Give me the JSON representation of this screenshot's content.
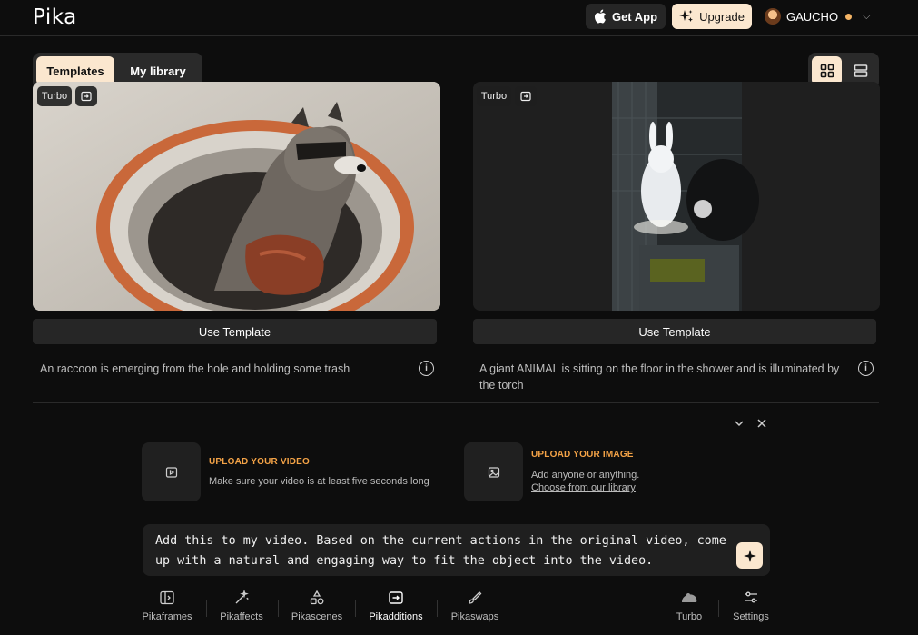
{
  "header": {
    "logo": "Pika",
    "get_app_label": "Get App",
    "upgrade_label": "Upgrade",
    "username": "GAUCHO"
  },
  "tabs": [
    {
      "label": "Templates",
      "active": true
    },
    {
      "label": "My library",
      "active": false
    }
  ],
  "view_toggle": {
    "active": "grid"
  },
  "cards": [
    {
      "badge": "Turbo",
      "button_label": "Use Template",
      "description": "An raccoon is emerging from the hole and holding some trash"
    },
    {
      "badge": "Turbo",
      "button_label": "Use Template",
      "description": "A giant ANIMAL is sitting on the floor in the shower and is illuminated by the torch"
    }
  ],
  "upload": {
    "video": {
      "title": "UPLOAD YOUR VIDEO",
      "subtitle": "Make sure your video is at least five seconds long"
    },
    "image": {
      "title": "UPLOAD YOUR IMAGE",
      "subtitle": "Add anyone or anything.",
      "link": "Choose from our library"
    }
  },
  "prompt": {
    "text": "Add this to my video. Based on the current actions in the original video, come up with a natural and engaging way to fit the object into the video."
  },
  "toolbar": {
    "items": [
      {
        "label": "Pikaframes",
        "icon": "frames-icon"
      },
      {
        "label": "Pikaffects",
        "icon": "magic-wand-icon"
      },
      {
        "label": "Pikascenes",
        "icon": "shapes-icon"
      },
      {
        "label": "Pikadditions",
        "icon": "add-box-icon",
        "active": true
      },
      {
        "label": "Pikaswaps",
        "icon": "brush-icon"
      },
      {
        "label": "Turbo",
        "icon": "turbo-icon"
      },
      {
        "label": "Settings",
        "icon": "sliders-icon"
      }
    ]
  },
  "colors": {
    "background": "#0d0d0d",
    "accent": "#fbe7cf",
    "upload_title": "#f4a347"
  }
}
